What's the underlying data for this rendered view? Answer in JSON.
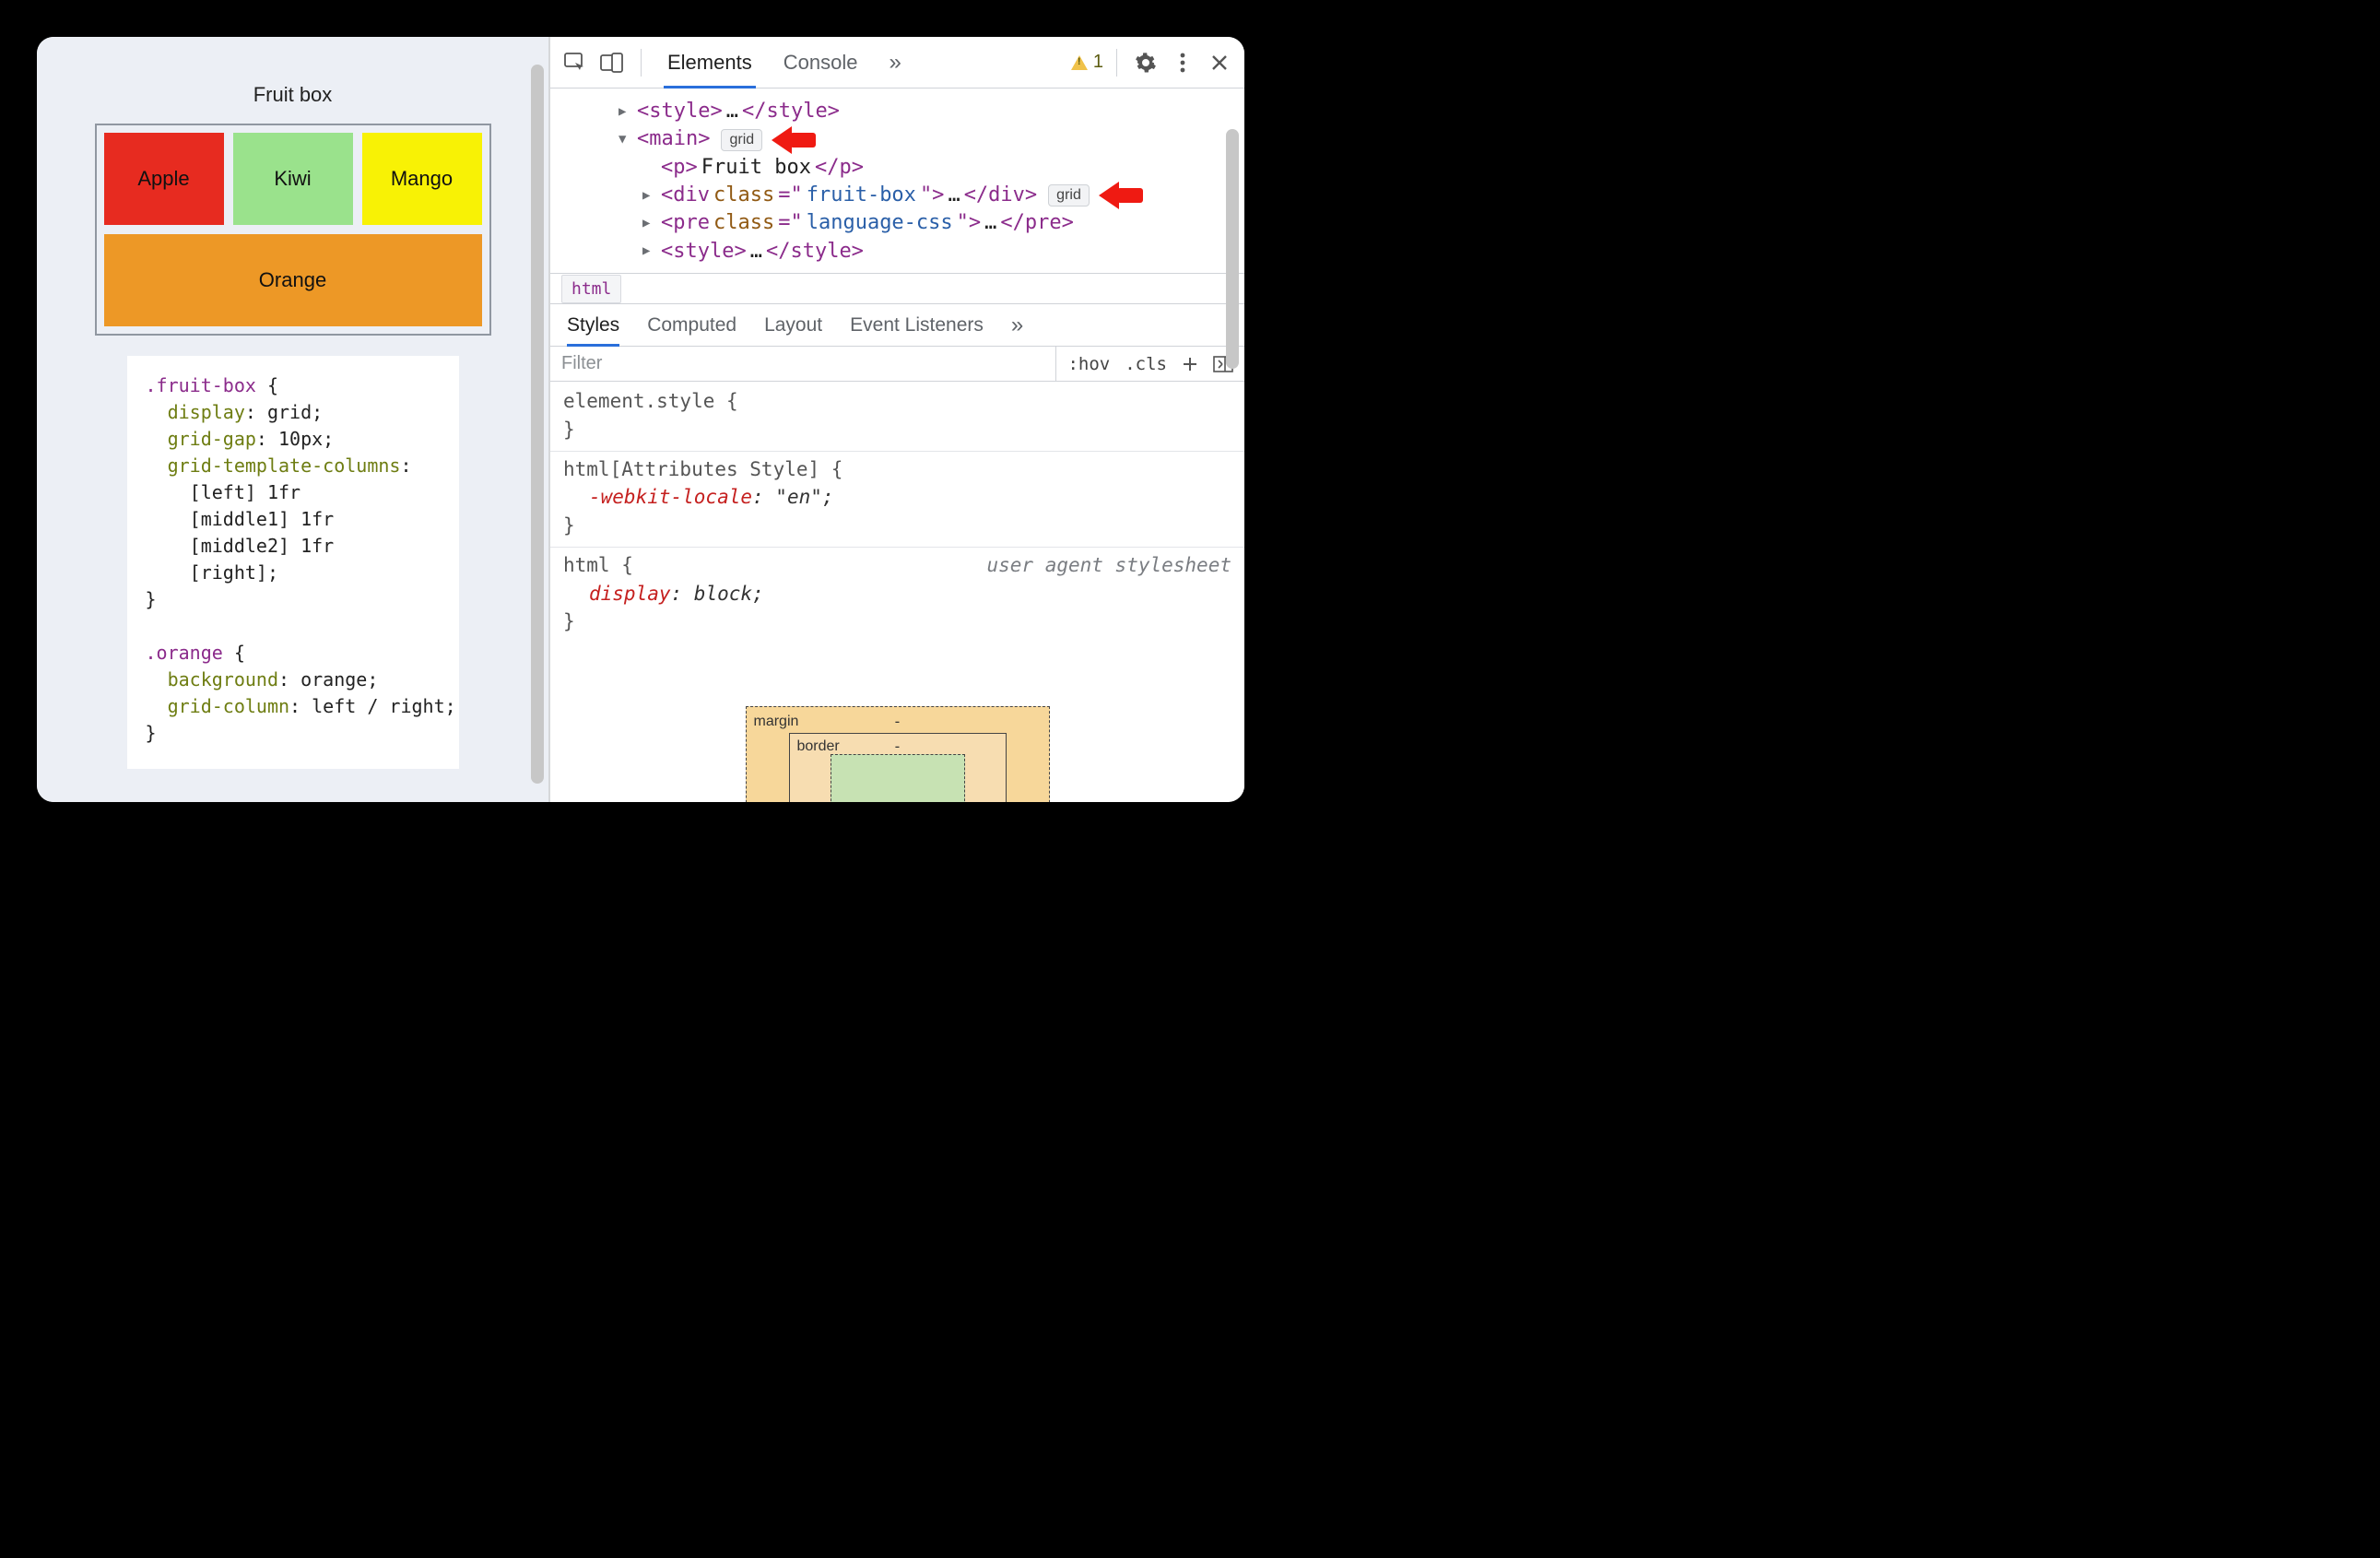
{
  "page": {
    "title": "Fruit box",
    "fruits": {
      "a": "Apple",
      "b": "Kiwi",
      "c": "Mango",
      "d": "Orange"
    },
    "code": ".fruit-box {\n  display: grid;\n  grid-gap: 10px;\n  grid-template-columns:\n    [left] 1fr\n    [middle1] 1fr\n    [middle2] 1fr\n    [right];\n}\n\n.orange {\n  background: orange;\n  grid-column: left / right;\n}"
  },
  "devtools": {
    "tabs": {
      "elements": "Elements",
      "console": "Console",
      "overflow": "»"
    },
    "warning_count": "1",
    "dom": {
      "style1_open": "<style>",
      "style1_ell": "…",
      "style1_close": "</style>",
      "main_open": "<main>",
      "main_badge": "grid",
      "p_open": "<p>",
      "p_text": "Fruit box",
      "p_close": "</p>",
      "div_open_a": "<div ",
      "div_classlabel": "class",
      "div_eq": "=\"",
      "div_classval": "fruit-box",
      "div_open_b": "\">",
      "div_ell": "…",
      "div_close": "</div>",
      "div_badge": "grid",
      "pre_open_a": "<pre ",
      "pre_classval": "language-css",
      "pre_open_b": "\">",
      "pre_ell": "…",
      "pre_close": "</pre>",
      "style2_open": "<style>",
      "style2_ell": "…",
      "style2_close": "</style>"
    },
    "breadcrumb": "html",
    "styles_tabs": {
      "styles": "Styles",
      "computed": "Computed",
      "layout": "Layout",
      "events": "Event Listeners",
      "overflow": "»"
    },
    "filter": {
      "placeholder": "Filter",
      "hov": ":hov",
      "cls": ".cls"
    },
    "rules": {
      "elstyle_sel": "element.style {",
      "close": "}",
      "attr_sel": "html[Attributes Style] {",
      "attr_prop": "-webkit-locale",
      "attr_val": ": \"en\";",
      "html_sel": "html {",
      "html_prop": "display",
      "html_val": ": block;",
      "uas": "user agent stylesheet"
    },
    "boxmodel": {
      "margin": "margin",
      "border": "border",
      "dash": "-"
    }
  }
}
